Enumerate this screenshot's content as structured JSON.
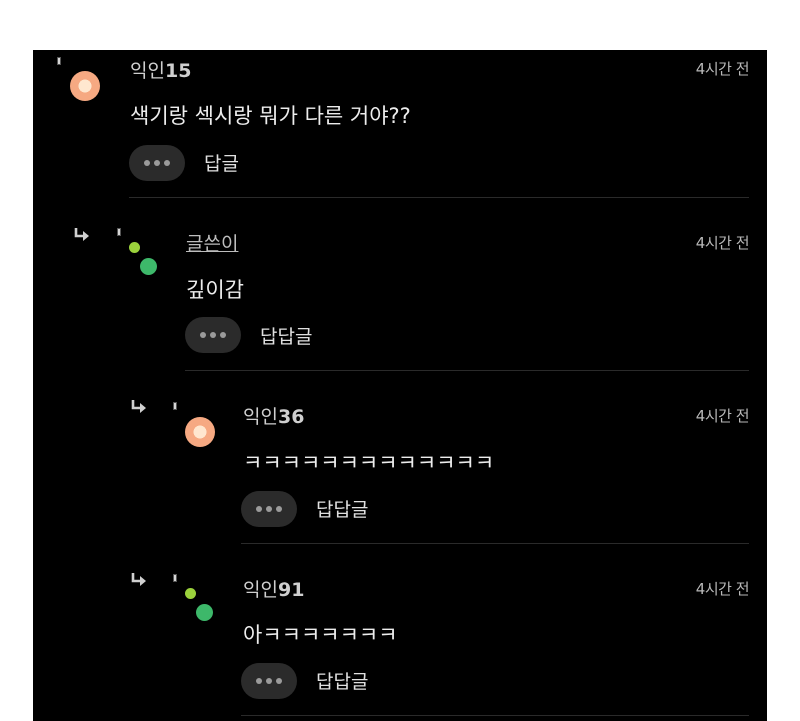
{
  "comments": [
    {
      "author": "익인",
      "number": "15",
      "time": "4시간 전",
      "text": "색기랑 섹시랑 뭐가 다른 거야??",
      "reply_label": "답글"
    },
    {
      "author": "글쓴이",
      "number": "",
      "time": "4시간 전",
      "text": "깊이감",
      "reply_label": "답답글"
    },
    {
      "author": "익인",
      "number": "36",
      "time": "4시간 전",
      "text": "ㅋㅋㅋㅋㅋㅋㅋㅋㅋㅋㅋㅋㅋ",
      "reply_label": "답답글"
    },
    {
      "author": "익인",
      "number": "91",
      "time": "4시간 전",
      "text": "아ㅋㅋㅋㅋㅋㅋㅋ",
      "reply_label": "답답글"
    }
  ],
  "icons": {
    "more": "more-dots-icon",
    "reply_arrow": "reply-arrow-icon",
    "avatar_anon": "orange-circle-avatar",
    "avatar_author": "green-dots-avatar"
  },
  "colors": {
    "background": "#000000",
    "text": "#ededed",
    "button_bg": "#2b2b2b",
    "avatar_orange": "#f6a982",
    "avatar_green": "#3db86a",
    "avatar_lime": "#9bd23c"
  }
}
